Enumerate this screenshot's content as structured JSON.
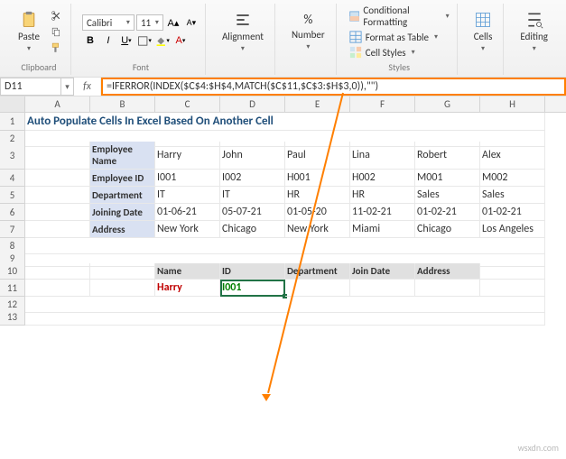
{
  "ribbon": {
    "paste": "Paste",
    "clipboard_label": "Clipboard",
    "font_name": "Calibri",
    "font_size": "11",
    "font_label": "Font",
    "alignment": "Alignment",
    "number": "Number",
    "styles": {
      "cond": "Conditional Formatting",
      "table": "Format as Table",
      "cell": "Cell Styles",
      "label": "Styles"
    },
    "cells": "Cells",
    "editing": "Editing"
  },
  "name_box": "D11",
  "formula": "=IFERROR(INDEX($C$4:$H$4,MATCH($C$11,$C$3:$H$3,0)),\"\")",
  "columns": [
    "",
    "A",
    "B",
    "C",
    "D",
    "E",
    "F",
    "G",
    "H"
  ],
  "title": "Auto Populate Cells In Excel Based On Another Cell",
  "table": {
    "row_headers": [
      "Employee Name",
      "Employee ID",
      "Department",
      "Joining Date",
      "Address"
    ],
    "data": [
      [
        "Harry",
        "John",
        "Paul",
        "Lina",
        "Robert",
        "Alex"
      ],
      [
        "I001",
        "I002",
        "H001",
        "H002",
        "M001",
        "M002"
      ],
      [
        "IT",
        "IT",
        "HR",
        "HR",
        "Sales",
        "Sales"
      ],
      [
        "01-06-21",
        "05-07-21",
        "01-05-20",
        "11-02-21",
        "01-02-21",
        "01-02-21"
      ],
      [
        "New York",
        "Chicago",
        "New York",
        "Miami",
        "Chicago",
        "Los Angeles"
      ]
    ]
  },
  "lookup": {
    "headers": [
      "Name",
      "ID",
      "Department",
      "Join Date",
      "Address"
    ],
    "values": [
      "Harry",
      "I001",
      "",
      "",
      ""
    ]
  },
  "watermark": "wsxdn.com"
}
